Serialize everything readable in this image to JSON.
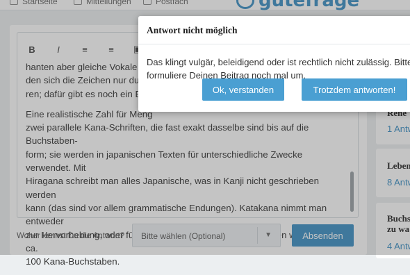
{
  "nav": {
    "home": "Startseite",
    "messages": "Mitteilungen",
    "mailbox": "Postfach",
    "logo": "gutefrage"
  },
  "editor": {
    "toolbar": [
      "B",
      "I",
      "≡",
      "≡",
      "▣"
    ],
    "lines_top": [
      "hanten aber gleiche Vokale gleiche Zeichen",
      "den sich die Zeichen nur durch",
      "ren; dafür gibt es noch ein Extra"
    ],
    "paragraph": [
      "Eine realistische Zahl für Meng",
      "zwei parallele Kana-Schriften, die fast exakt dasselbe sind bis auf die Buchstaben-",
      "form; sie werden in japanischen Texten für unterschiedliche Zwecke verwendet. Mit",
      "Hiragana schreibt man alles Japanische, was in Kanji nicht geschrieben werden",
      "kann (das sind vor allem grammatische Endungen). Katakana nimmt man entweder",
      "zur Hervorhebung, oder für Fremdsprachiges. Insgesamt haben wir dann also ca.",
      "100 Kana-Buchstaben."
    ]
  },
  "form": {
    "source_label": "Woher kennst Du die Antwort?",
    "select_value": "Bitte wählen (Optional)",
    "submit": "Absenden"
  },
  "sidebar": {
    "card1_title": "Rene",
    "card1_link": "1 Antw",
    "card2_title": "Leben",
    "card2_link": "8 Antw",
    "card3_title_line1": "Buchs",
    "card3_title_line2": "zu wa",
    "card3_link": "4 Antw"
  },
  "dialog": {
    "title": "Antwort nicht möglich",
    "message": "Das klingt vulgär, beleidigend oder ist rechtlich nicht zulässig. Bitte formuliere Deinen Beitrag noch mal um.",
    "ok_button": "Ok, verstanden",
    "anyway_button": "Trotzdem antworten!"
  },
  "colors": {
    "accent": "#3b8fc4",
    "button": "#4a9fd2",
    "overlay": "rgba(70,70,70,0.32)"
  }
}
